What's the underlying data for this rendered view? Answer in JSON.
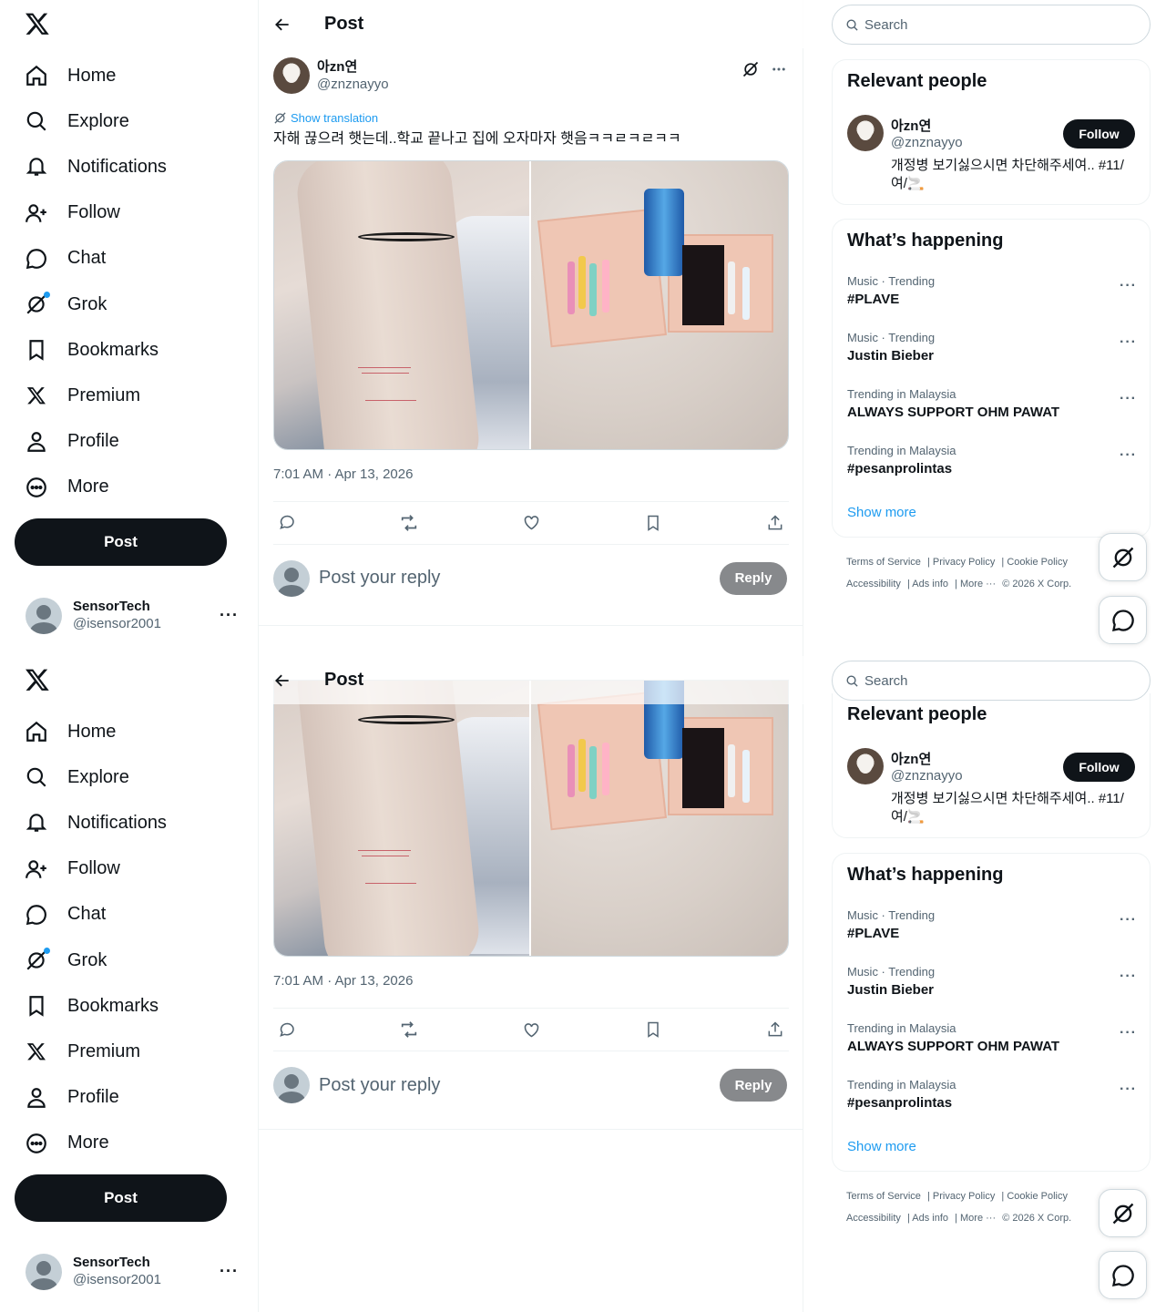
{
  "nav": {
    "items": [
      {
        "label": "Home",
        "icon": "home-icon"
      },
      {
        "label": "Explore",
        "icon": "search-icon"
      },
      {
        "label": "Notifications",
        "icon": "bell-icon"
      },
      {
        "label": "Follow",
        "icon": "add-user-icon"
      },
      {
        "label": "Chat",
        "icon": "chat-bubble-icon"
      },
      {
        "label": "Grok",
        "icon": "grok-icon"
      },
      {
        "label": "Bookmarks",
        "icon": "bookmark-icon"
      },
      {
        "label": "Premium",
        "icon": "x-logo-icon"
      },
      {
        "label": "Profile",
        "icon": "person-icon"
      },
      {
        "label": "More",
        "icon": "more-circle-icon"
      }
    ],
    "post_label": "Post"
  },
  "account": {
    "name": "SensorTech",
    "handle": "@isensor2001",
    "more": "···"
  },
  "header": {
    "title": "Post"
  },
  "tweet": {
    "name": "아zn연",
    "handle": "@znznayyo",
    "translate_label": "Show translation",
    "text": "자해 끊으려 햇는데..학교 끝나고 집에 오자마자 햇음ㅋㅋㄹㅋㄹㅋㅋ",
    "timestamp": "7:01 AM · Apr 13, 2026"
  },
  "reply": {
    "placeholder": "Post your reply",
    "button": "Reply"
  },
  "search": {
    "placeholder": "Search"
  },
  "relevant": {
    "title": "Relevant people",
    "name": "아zn연",
    "handle": "@znznayyo",
    "bio": "개정병 보기싫으시면 차단해주세여.. #11/여/🚬",
    "follow_label": "Follow"
  },
  "happening": {
    "title": "What’s happening",
    "trends": [
      {
        "meta": "Music · Trending",
        "title": "#PLAVE"
      },
      {
        "meta": "Music · Trending",
        "title": "Justin Bieber"
      },
      {
        "meta": "Trending in Malaysia",
        "title": "ALWAYS SUPPORT OHM PAWAT"
      },
      {
        "meta": "Trending in Malaysia",
        "title": "#pesanprolintas"
      }
    ],
    "show_more": "Show more"
  },
  "footer": {
    "links": [
      "Terms of Service",
      "Privacy Policy",
      "Cookie Policy",
      "Accessibility",
      "Ads info",
      "More ···"
    ],
    "copyright": "© 2026 X Corp."
  },
  "colors": {
    "accent": "#1d9bf0",
    "text": "#0f1419",
    "muted": "#536471",
    "reply_disabled": "#87898c"
  }
}
